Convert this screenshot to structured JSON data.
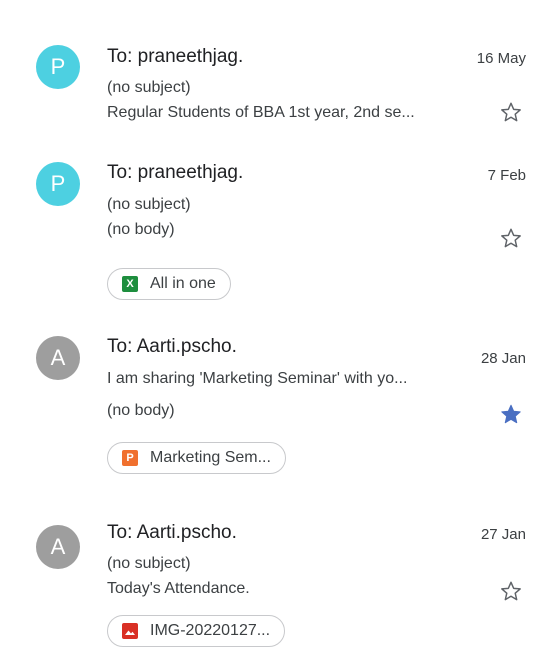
{
  "colors": {
    "avatar_p": "#4dd0e1",
    "avatar_a": "#9e9e9e",
    "star_filled": "#4a6fc2",
    "excel_green": "#1e8e3e",
    "slides_orange": "#f0702e",
    "image_red": "#d93025"
  },
  "emails": [
    {
      "avatar_letter": "P",
      "sender": "To: praneethjag.",
      "date": "16 May",
      "line1": "(no subject)",
      "line2": "Regular Students of BBA 1st year, 2nd se...",
      "starred": false
    },
    {
      "avatar_letter": "P",
      "sender": "To: praneethjag.",
      "date": "7 Feb",
      "line1": "(no subject)",
      "line2": "(no body)",
      "starred": false,
      "attachment": {
        "icon": "excel-icon",
        "icon_glyph": "X",
        "label": "All in one"
      }
    },
    {
      "avatar_letter": "A",
      "sender": "To: Aarti.pscho.",
      "date": "28 Jan",
      "line1": "I am sharing 'Marketing Seminar' with yo...",
      "line2": "(no body)",
      "starred": true,
      "attachment": {
        "icon": "slides-icon",
        "icon_glyph": "P",
        "label": "Marketing Sem..."
      }
    },
    {
      "avatar_letter": "A",
      "sender": "To: Aarti.pscho.",
      "date": "27 Jan",
      "line1": "(no subject)",
      "line2": "Today's Attendance.",
      "starred": false,
      "attachment": {
        "icon": "image-icon",
        "icon_glyph": "",
        "label": "IMG-20220127..."
      }
    }
  ]
}
